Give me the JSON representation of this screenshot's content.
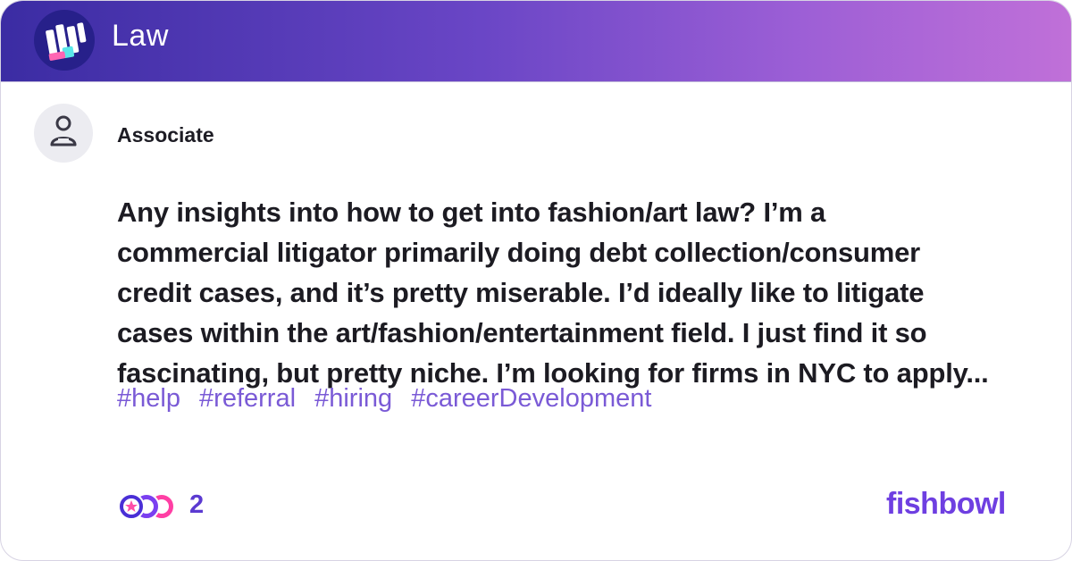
{
  "header": {
    "title": "Law",
    "logo_icon": "law-bowl-logo-icon",
    "gradient_start": "#3b2ca3",
    "gradient_end": "#c070d8"
  },
  "post": {
    "author": "Associate",
    "avatar_icon": "anonymous-user-icon",
    "text_lines": [
      "Any insights into how to get into fashion/art law? I’m a",
      "commercial litigator primarily doing debt collection/consumer",
      "credit cases, and it’s pretty miserable. I’d ideally like to litigate",
      "cases within the art/fashion/entertainment field. I just find it so",
      "fascinating, but pretty niche. I’m looking for firms in NYC to apply..."
    ],
    "tags": [
      "#help",
      "#referral",
      "#hiring",
      "#careerDevelopment"
    ],
    "tag_color": "#7a5ad6"
  },
  "footer": {
    "reaction_icons": [
      "star-reaction-icon",
      "heart-reaction-icon",
      "laugh-reaction-icon"
    ],
    "reaction_count": "2",
    "brand": "fishbowl",
    "brand_color": "#6e3fe1"
  }
}
